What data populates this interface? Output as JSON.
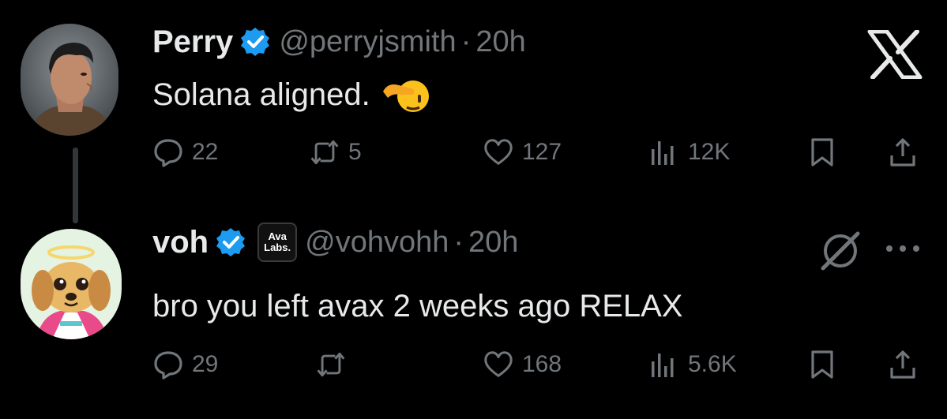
{
  "tweet1": {
    "name": "Perry",
    "handle": "@perryjsmith",
    "separator": "·",
    "time": "20h",
    "text": "Solana aligned.",
    "emoji": "saluting-face",
    "replies": "22",
    "reposts": "5",
    "likes": "127",
    "views": "12K"
  },
  "tweet2": {
    "name": "voh",
    "affiliate_badge": "Ava Labs.",
    "affiliate_line1": "Ava",
    "affiliate_line2": "Labs.",
    "handle": "@vohvohh",
    "separator": "·",
    "time": "20h",
    "text": "bro you left avax 2 weeks ago RELAX",
    "replies": "29",
    "reposts": "",
    "likes": "168",
    "views": "5.6K"
  },
  "icons": {
    "app_logo": "x-logo-icon",
    "grok": "grok-icon",
    "more": "more-dots-icon",
    "reply": "reply-icon",
    "repost": "repost-icon",
    "like": "heart-icon",
    "views": "views-icon",
    "bookmark": "bookmark-icon",
    "share": "share-icon",
    "verified": "verified-badge-icon"
  },
  "colors": {
    "background": "#000000",
    "text_primary": "#e7e9ea",
    "text_secondary": "#71767b",
    "verified_blue": "#1d9bf0",
    "thread_line": "#333639"
  }
}
